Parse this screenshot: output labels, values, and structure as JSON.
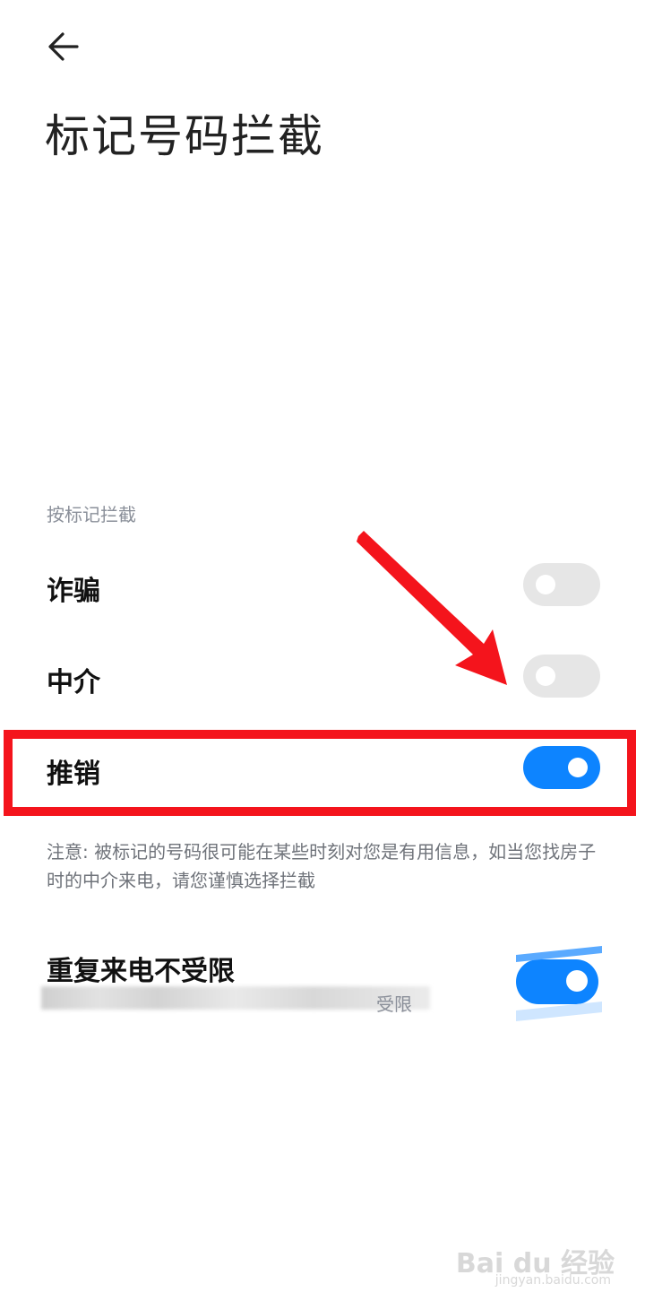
{
  "header": {
    "title": "标记号码拦截"
  },
  "section": {
    "title": "按标记拦截"
  },
  "rows": [
    {
      "label": "诈骗",
      "enabled": false
    },
    {
      "label": "中介",
      "enabled": false
    },
    {
      "label": "推销",
      "enabled": true
    }
  ],
  "note": "注意: 被标记的号码很可能在某些时刻对您是有用信息，如当您找房子时的中介来电，请您谨慎选择拦截",
  "repeat_call": {
    "title": "重复来电不受限",
    "subtitle_visible_tail": "受限",
    "enabled": true
  },
  "watermark": {
    "brand": "Bai du 经验",
    "url": "jingyan.baidu.com"
  },
  "colors": {
    "accent": "#0d84ff",
    "toggle_off": "#e6e6e6",
    "highlight": "#f4141c",
    "arrow": "#f4141c"
  }
}
